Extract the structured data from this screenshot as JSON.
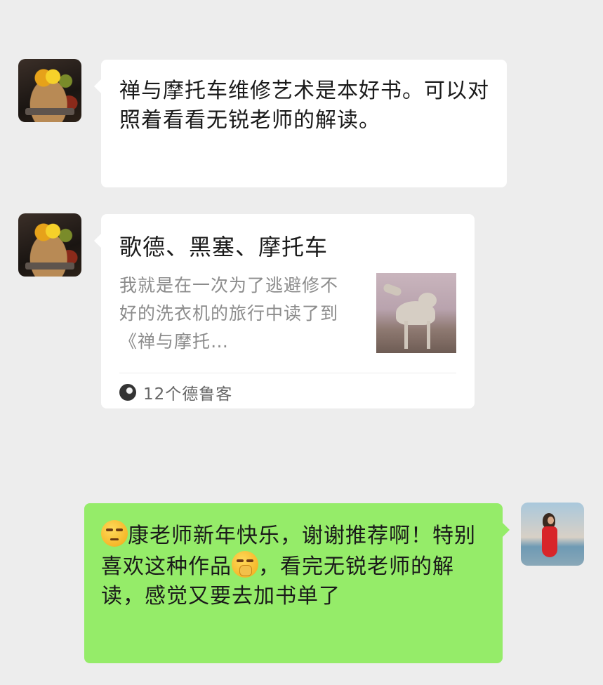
{
  "messages": [
    {
      "side": "left",
      "type": "text",
      "avatar": "food-photo-avatar",
      "text": "禅与摩托车维修艺术是本好书。可以对照着看看无锐老师的解读。"
    },
    {
      "side": "left",
      "type": "link-card",
      "avatar": "food-photo-avatar",
      "card": {
        "title": "歌德、黑塞、摩托车",
        "description": "我就是在一次为了逃避修不好的洗衣机的旅行中读了到《禅与摩托…",
        "thumbnail": "camel-photo",
        "source": "12个德鲁客"
      }
    },
    {
      "side": "right",
      "type": "text",
      "avatar": "woman-beach-avatar",
      "emoji_start": "smirk-emoji",
      "part1": "康老师新年快乐，谢谢推荐啊！特别喜欢这种作品",
      "emoji_mid": "shy-emoji",
      "part2": "，看完无锐老师的解读，感觉又要去加书单了"
    }
  ],
  "colors": {
    "background": "#ededed",
    "incoming_bubble": "#ffffff",
    "outgoing_bubble": "#95ec69"
  }
}
